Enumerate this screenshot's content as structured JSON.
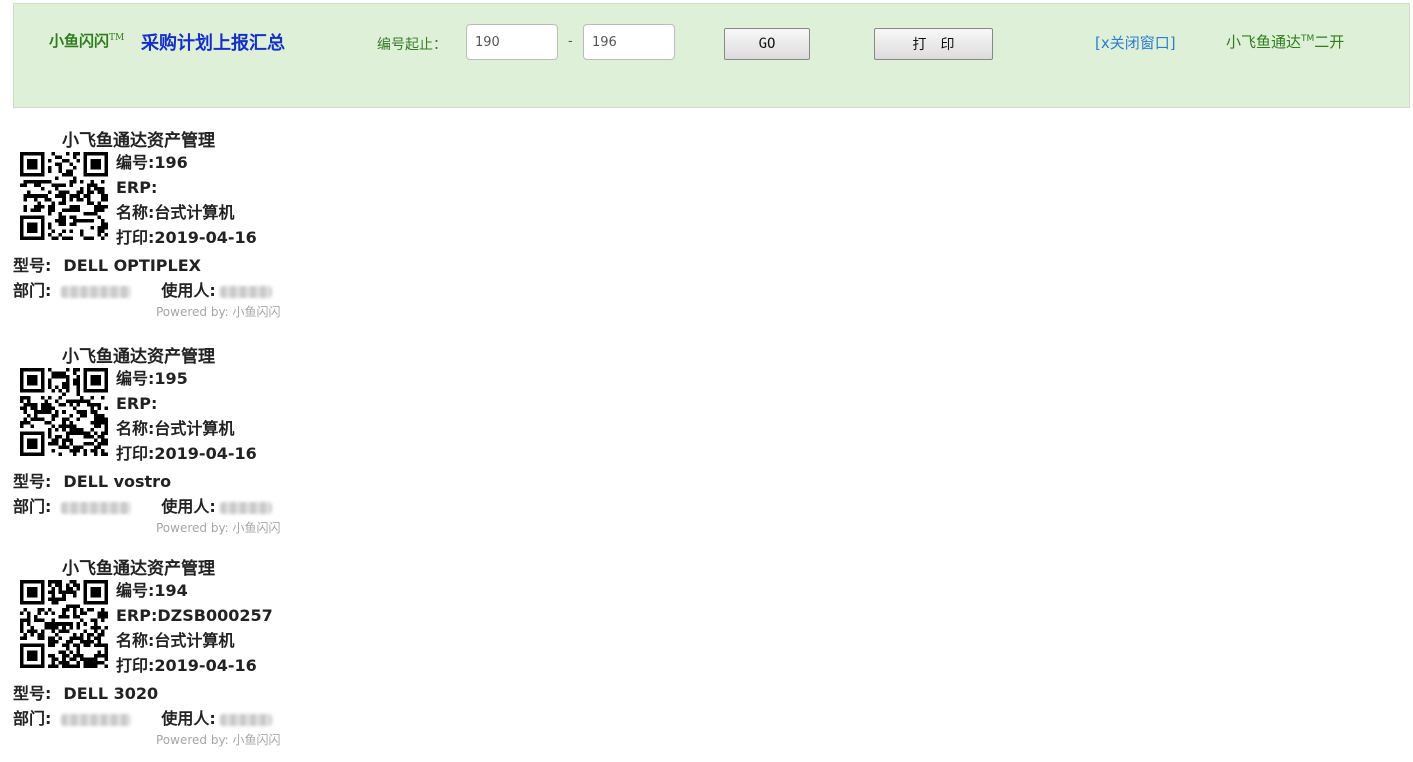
{
  "header": {
    "brand": "小鱼闪闪",
    "brand_tm": "TM",
    "title": "采购计划上报汇总",
    "range_label": "编号起止：",
    "range_start": "190",
    "range_sep": "-",
    "range_end": "196",
    "go_label": "GO",
    "print_label": "打　印",
    "close_label": "[x关闭窗口]",
    "app2_name": "小飞鱼通达",
    "app2_tm": "TM",
    "app2_suffix": "二开"
  },
  "labels": [
    {
      "title": "小飞鱼通达资产管理",
      "code": "编号:196",
      "erp": "ERP:",
      "name": "名称:台式计算机",
      "print_date": "打印:2019-04-16",
      "model_label": "型号:",
      "model_value": "DELL OPTIPLEX",
      "dept_label": "部门:",
      "user_label": "使用人:",
      "powered": "Powered by: 小鱼闪闪"
    },
    {
      "title": "小飞鱼通达资产管理",
      "code": "编号:195",
      "erp": "ERP:",
      "name": "名称:台式计算机",
      "print_date": "打印:2019-04-16",
      "model_label": "型号:",
      "model_value": "DELL vostro",
      "dept_label": "部门:",
      "user_label": "使用人:",
      "powered": "Powered by: 小鱼闪闪"
    },
    {
      "title": "小飞鱼通达资产管理",
      "code": "编号:194",
      "erp": "ERP:DZSB000257",
      "name": "名称:台式计算机",
      "print_date": "打印:2019-04-16",
      "model_label": "型号:",
      "model_value": "DELL 3020",
      "dept_label": "部门:",
      "user_label": "使用人:",
      "powered": "Powered by: 小鱼闪闪"
    }
  ]
}
